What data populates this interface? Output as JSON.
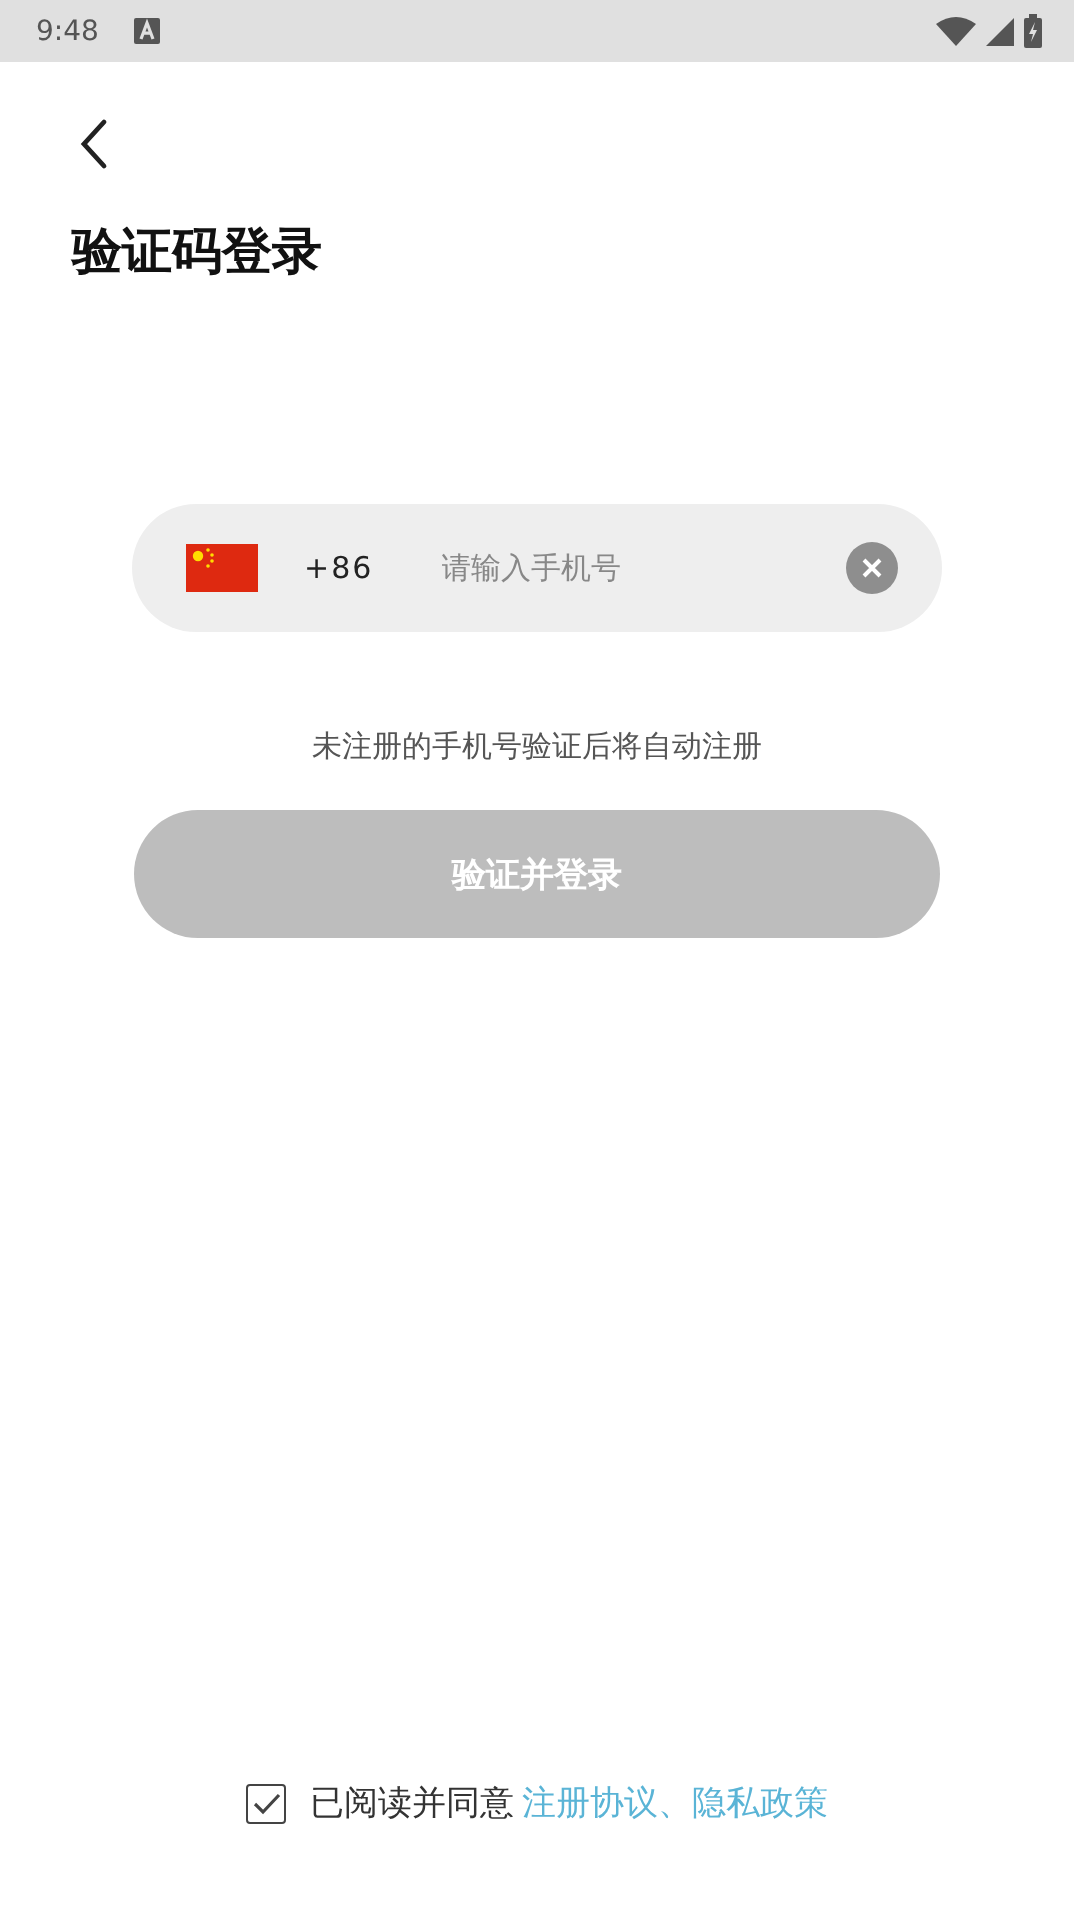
{
  "status_bar": {
    "time": "9:48"
  },
  "title": "验证码登录",
  "phone": {
    "country_code": "+86",
    "placeholder": "请输入手机号"
  },
  "hint": "未注册的手机号验证后将自动注册",
  "login_button": {
    "label": "验证并登录",
    "disabled": true
  },
  "agreement": {
    "checked": true,
    "text": "已阅读并同意",
    "link": "注册协议、隐私政策"
  }
}
